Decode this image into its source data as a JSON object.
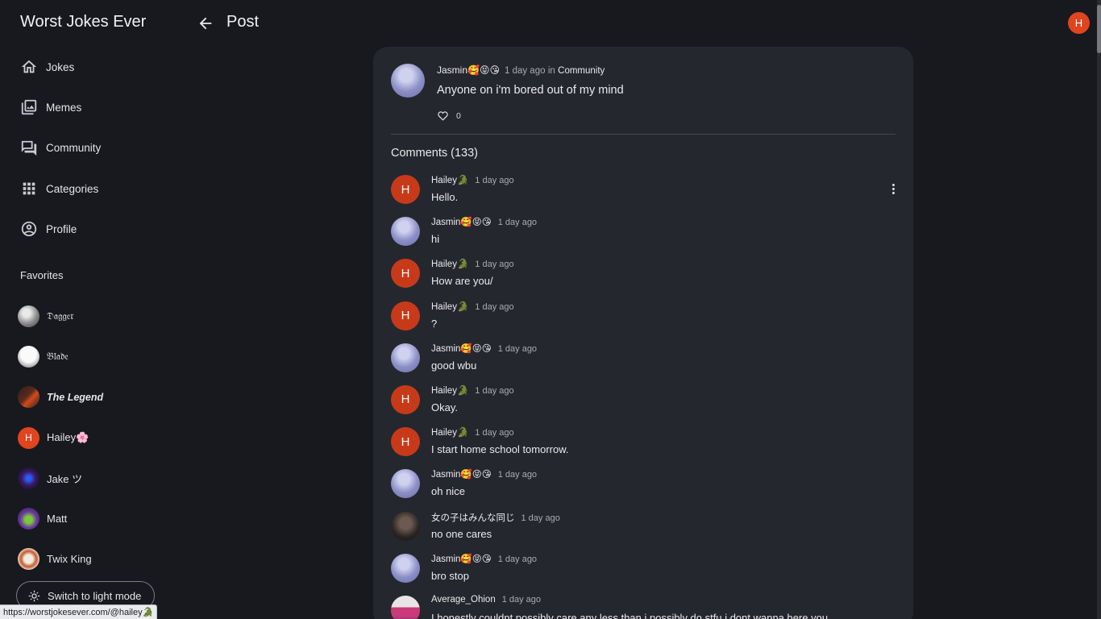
{
  "app": {
    "title": "Worst Jokes Ever"
  },
  "nav": [
    {
      "label": "Jokes",
      "icon": "home-icon"
    },
    {
      "label": "Memes",
      "icon": "image-library-icon"
    },
    {
      "label": "Community",
      "icon": "forum-icon"
    },
    {
      "label": "Categories",
      "icon": "grid-icon"
    },
    {
      "label": "Profile",
      "icon": "account-circle-icon"
    }
  ],
  "favorites": {
    "title": "Favorites",
    "items": [
      {
        "label": "𝔇𝔞𝔤𝔤𝔢𝔯",
        "avatar": "dagger"
      },
      {
        "label": "𝔅𝔩𝔞𝔡𝔢",
        "avatar": "blade"
      },
      {
        "label": "The Legend",
        "avatar": "legend"
      },
      {
        "label": "Hailey🌸",
        "avatar": "letter",
        "initial": "H"
      },
      {
        "label": "Jake ツ",
        "avatar": "jake"
      },
      {
        "label": "Matt",
        "avatar": "matt"
      },
      {
        "label": "Twix King",
        "avatar": "twix"
      }
    ]
  },
  "theme_toggle": {
    "label": "Switch to light mode"
  },
  "status_url": "https://worstjokesever.com/@hailey🐊",
  "header": {
    "title": "Post",
    "user_initial": "H"
  },
  "post": {
    "author": "Jasmin🥰😝😘",
    "time": "1 day ago",
    "in_word": "in",
    "category": "Community",
    "text": "Anyone on i'm bored out of my mind",
    "likes": "0"
  },
  "comments": {
    "title": "Comments (133)",
    "items": [
      {
        "author": "Hailey🐊",
        "time": "1 day ago",
        "text": "Hello.",
        "avatar": "h",
        "initial": "H"
      },
      {
        "author": "Jasmin🥰😝😘",
        "time": "1 day ago",
        "text": "hi",
        "avatar": "j",
        "initial": ""
      },
      {
        "author": "Hailey🐊",
        "time": "1 day ago",
        "text": "How are you/",
        "avatar": "h",
        "initial": "H"
      },
      {
        "author": "Hailey🐊",
        "time": "1 day ago",
        "text": "?",
        "avatar": "h",
        "initial": "H"
      },
      {
        "author": "Jasmin🥰😝😘",
        "time": "1 day ago",
        "text": "good wbu",
        "avatar": "j",
        "initial": ""
      },
      {
        "author": "Hailey🐊",
        "time": "1 day ago",
        "text": "Okay.",
        "avatar": "h",
        "initial": "H"
      },
      {
        "author": "Hailey🐊",
        "time": "1 day ago",
        "text": "I start home school tomorrow.",
        "avatar": "h",
        "initial": "H"
      },
      {
        "author": "Jasmin🥰😝😘",
        "time": "1 day ago",
        "text": "oh nice",
        "avatar": "j",
        "initial": ""
      },
      {
        "author": "女の子はみんな同じ",
        "time": "1 day ago",
        "text": "no one cares",
        "avatar": "dark",
        "initial": ""
      },
      {
        "author": "Jasmin🥰😝😘",
        "time": "1 day ago",
        "text": "bro stop",
        "avatar": "j",
        "initial": ""
      },
      {
        "author": "Average_Ohion",
        "time": "1 day ago",
        "text": "I honestly couldnt possibly care any less than i possibly do stfu i dont wanna here you",
        "avatar": "ohio",
        "initial": ""
      }
    ]
  }
}
